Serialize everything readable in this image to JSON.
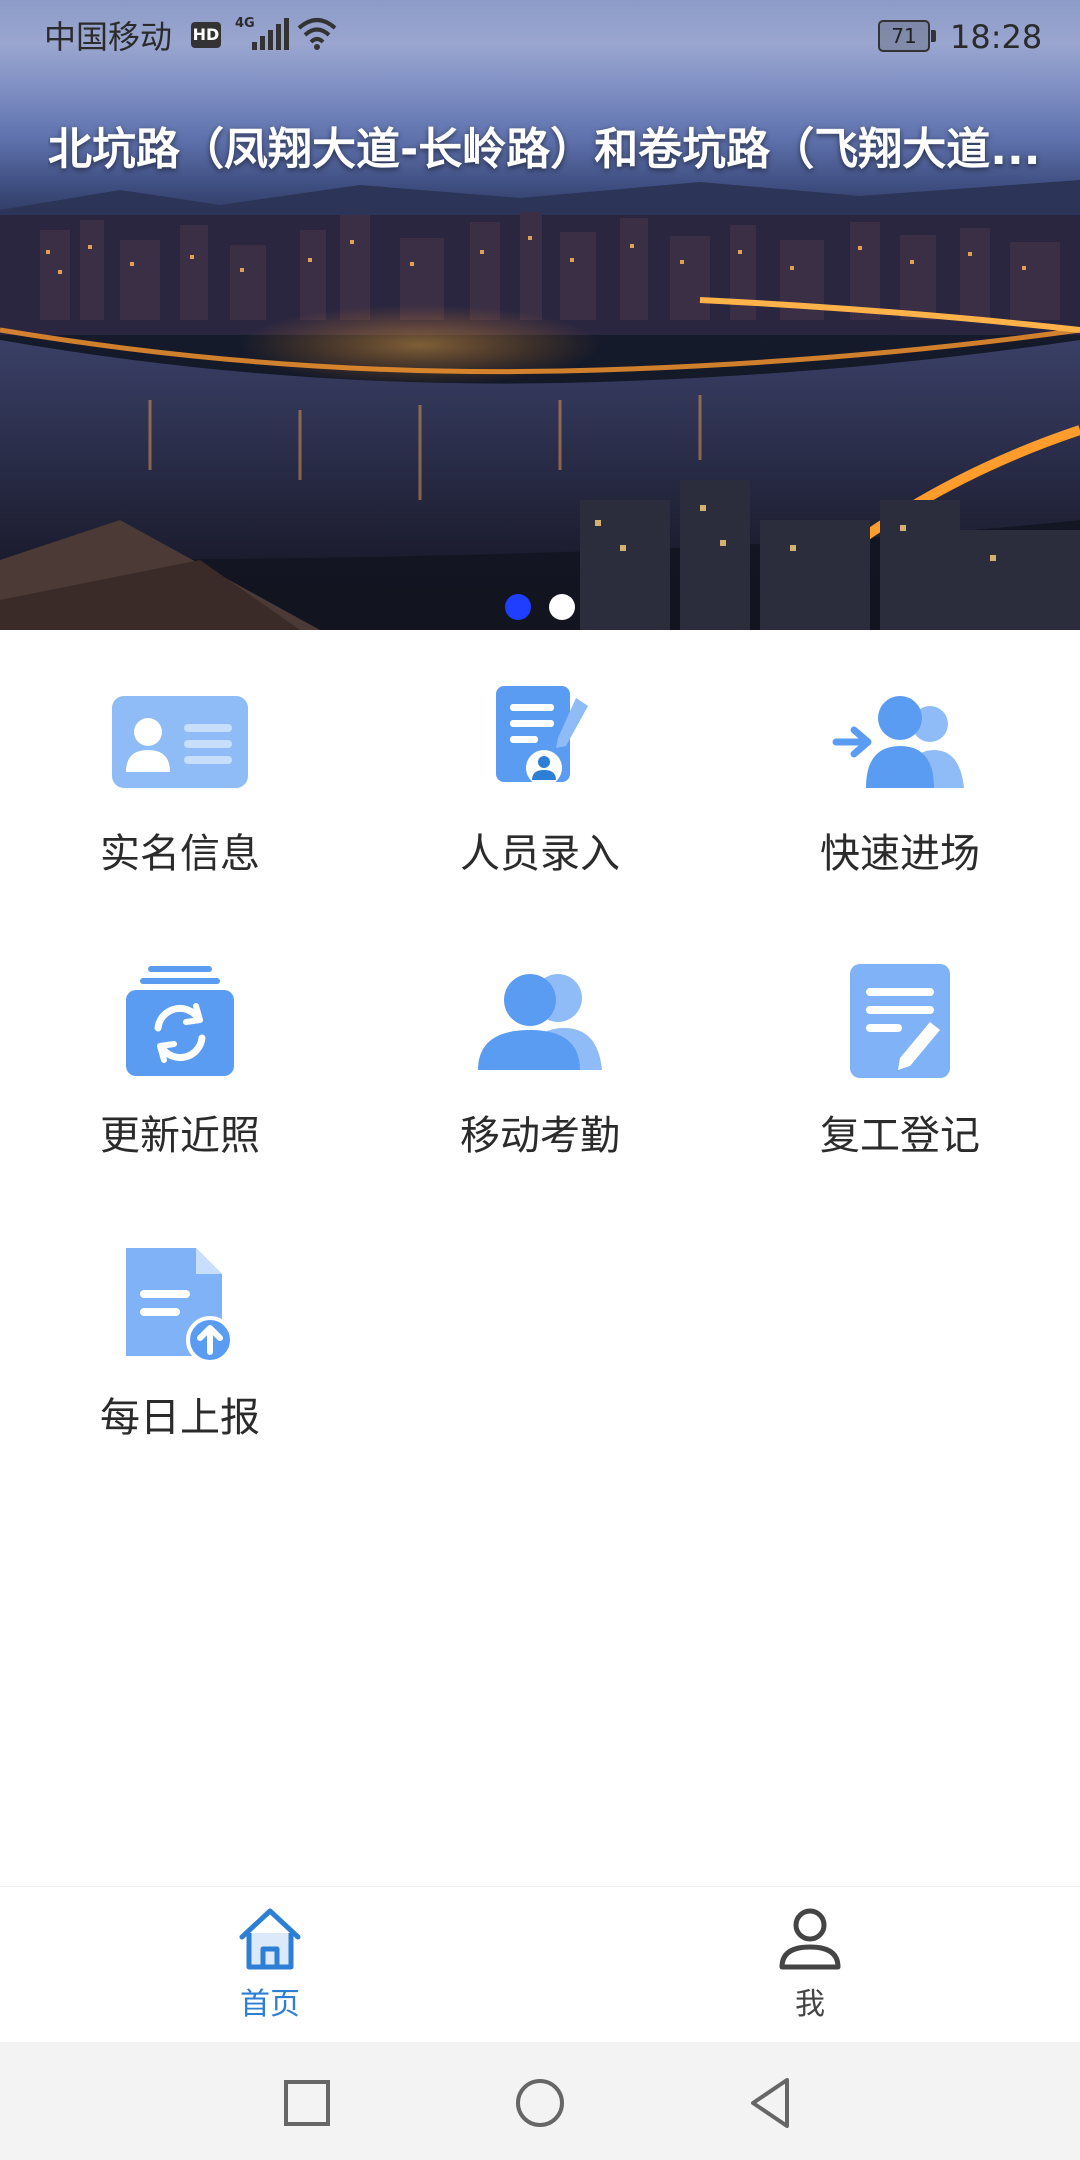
{
  "status_bar": {
    "carrier": "中国移动",
    "hd_badge": "HD",
    "network_type": "4G",
    "battery_level": "71",
    "time": "18:28"
  },
  "banner": {
    "title": "北坑路（凤翔大道-长岭路）和卷坑路（飞翔大道...",
    "slide_count": 2,
    "active_slide": 1
  },
  "features": [
    {
      "label": "实名信息",
      "icon": "id-card-icon"
    },
    {
      "label": "人员录入",
      "icon": "document-edit-icon"
    },
    {
      "label": "快速进场",
      "icon": "group-enter-icon"
    },
    {
      "label": "更新近照",
      "icon": "photo-refresh-icon"
    },
    {
      "label": "移动考勤",
      "icon": "users-icon"
    },
    {
      "label": "复工登记",
      "icon": "form-pen-icon"
    },
    {
      "label": "每日上报",
      "icon": "file-upload-icon"
    }
  ],
  "tab_bar": {
    "home_label": "首页",
    "me_label": "我"
  },
  "colors": {
    "icon_blue": "#5b9cf3",
    "icon_blue_light": "#8fbcf7",
    "active_tab": "#2d7fd6",
    "active_dot": "#1f3fff"
  }
}
